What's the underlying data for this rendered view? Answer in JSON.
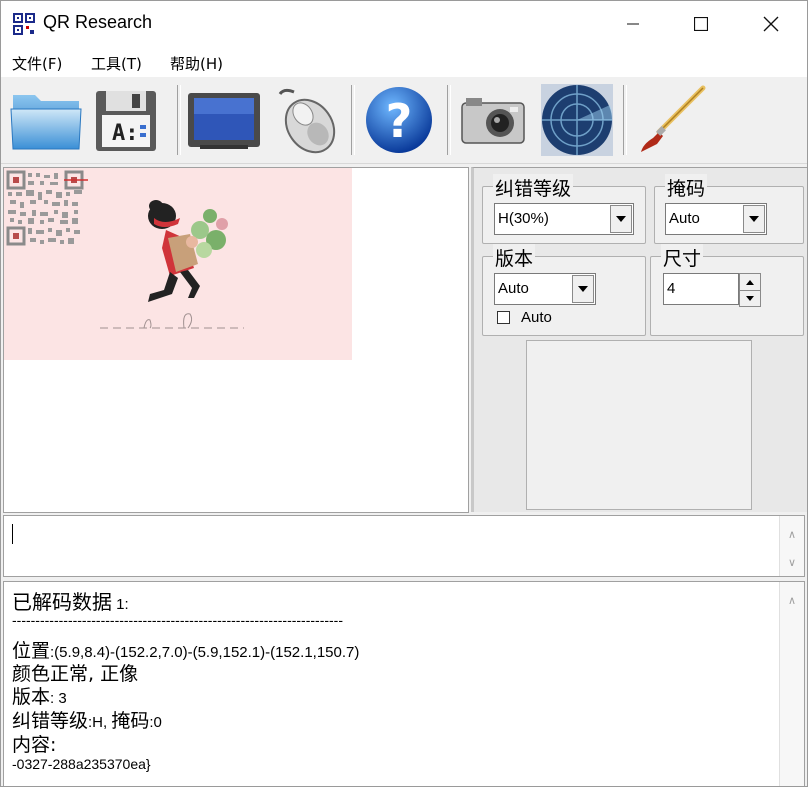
{
  "window": {
    "title": "QR Research",
    "icon": "qr-app-icon",
    "controls": [
      "minimize-icon",
      "maximize-icon",
      "close-icon"
    ]
  },
  "menu": {
    "file": "文件(F)",
    "tools": "工具(T)",
    "help": "帮助(H)"
  },
  "toolbar": {
    "buttons": [
      "folder-icon",
      "save-floppy-icon",
      "monitor-icon",
      "mouse-icon",
      "help-icon",
      "camera-icon",
      "radar-icon",
      "paintbrush-icon"
    ]
  },
  "settings": {
    "ec_level_label": "纠错等级",
    "ec_level_value": "H(30%)",
    "mask_label": "掩码",
    "mask_value": "Auto",
    "version_label": "版本",
    "version_value": "Auto",
    "version_auto_checkbox": "Auto",
    "size_label": "尺寸",
    "size_value": "4"
  },
  "input": {
    "text": ""
  },
  "output": {
    "header_cjk": "已解码数据",
    "header_num": " 1:",
    "separator": "-----------------------------------------------------------------------",
    "position_label": "位置",
    "position_value": ":(5.9,8.4)-(152.2,7.0)-(5.9,152.1)-(152.1,150.7)",
    "color_line": "颜色正常, 正像",
    "version_label": "版本",
    "version_value": ": 3",
    "ec_label": "纠错等级",
    "ec_value": ":H, ",
    "mask_label": "掩码",
    "mask_value": ":0",
    "content_label": "内容:",
    "content_value": "-0327-288a235370ea}"
  },
  "colors": {
    "preview_bg": "#fce4e4",
    "window_bg": "#f0f0f0"
  }
}
